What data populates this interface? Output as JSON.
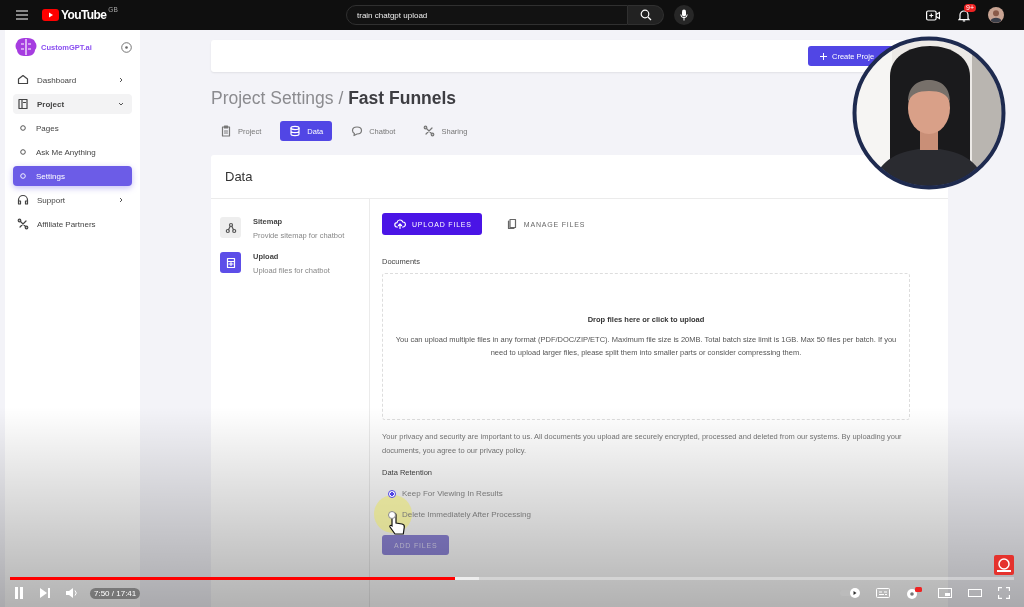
{
  "youtube": {
    "logo": "YouTube",
    "region": "GB",
    "search": {
      "value": "train chatgpt upload"
    },
    "notifications": "9+"
  },
  "app": {
    "brand": "CustomGPT.ai",
    "nav": [
      {
        "label": "Dashboard",
        "kind": "home",
        "expanded": false,
        "selected": false
      },
      {
        "label": "Project",
        "kind": "book",
        "expanded": true,
        "selected": false,
        "children": [
          {
            "label": "Pages",
            "selected": false
          },
          {
            "label": "Ask Me Anything",
            "selected": false
          },
          {
            "label": "Settings",
            "selected": true
          }
        ]
      },
      {
        "label": "Support",
        "kind": "headset",
        "expanded": false,
        "selected": false
      },
      {
        "label": "Affiliate Partners",
        "kind": "share",
        "selected": false
      }
    ]
  },
  "header": {
    "create_button": "Create Proje"
  },
  "page_title": "Project Settings / **Fast Funnels**",
  "tabs": [
    {
      "label": "Project",
      "kind": "clipboard",
      "selected": false
    },
    {
      "label": "Data",
      "kind": "database",
      "selected": true
    },
    {
      "label": "Chatbot",
      "kind": "chat",
      "selected": false
    },
    {
      "label": "Sharing",
      "kind": "share",
      "selected": false
    }
  ],
  "data_card": {
    "title": "Data",
    "sources": [
      {
        "kind": "sitemap",
        "title": "Sitemap",
        "description": "Provide sitemap for chatbot",
        "selected": false
      },
      {
        "kind": "upload",
        "title": "Upload",
        "description": "Upload files for chatbot",
        "selected": true
      }
    ],
    "upload_tabs": [
      {
        "label": "UPLOAD FILES",
        "kind": "cloud",
        "selected": true
      },
      {
        "label": "MANAGE FILES",
        "kind": "files",
        "selected": false
      }
    ],
    "documents_label": "Documents",
    "dropzone": {
      "title": "Drop files here or click to upload",
      "text": "You can upload multiple files in any format (PDF/DOC/ZIP/ETC). Maximum file size is 20MB. Total batch size limit is 1GB. Max 50 files per batch. If you need to upload larger files, please split them into smaller parts or consider compressing them."
    },
    "privacy_note": "Your privacy and security are important to us. All documents you upload are securely encrypted, processed and deleted from our systems. By uploading your documents, you agree to our privacy policy.",
    "retention_label": "Data Retention",
    "retention_options": [
      {
        "label": "Keep For Viewing In Results",
        "selected": true
      },
      {
        "label": "Delete Immediately After Processing",
        "selected": false
      }
    ],
    "add_button": {
      "label": "ADD FILES",
      "disabled": true
    }
  },
  "player": {
    "progress": {
      "level": 0.443,
      "buffer": {
        "level": 0.467
      }
    },
    "time": "7:50 / 17:41",
    "playing": true,
    "autoplay": true
  }
}
